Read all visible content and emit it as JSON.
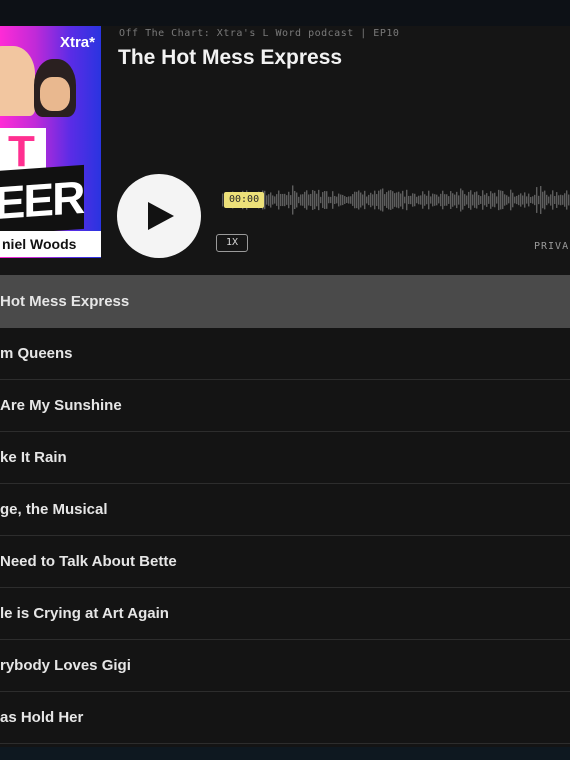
{
  "player": {
    "meta": "Off The Chart: Xtra's L Word podcast | EP10",
    "title": "The Hot Mess Express",
    "time": "00:00",
    "speed": "1X",
    "privacy": "PRIVA",
    "cover": {
      "brand": "Xtra*",
      "big_letter": "T",
      "headline": "EER",
      "host": "niel Woods"
    }
  },
  "episodes": [
    " Hot Mess Express",
    "m Queens",
    " Are My Sunshine",
    "ke It Rain",
    "ge, the Musical",
    " Need to Talk About Bette",
    "le is Crying at Art Again",
    "rybody Loves Gigi",
    "as Hold Her"
  ],
  "colors": {
    "background": "#141414",
    "active_row": "#4a4a4a",
    "time_badge": "#ece079",
    "waveform": "#5e5e5e",
    "play_button": "#f4f4f4"
  },
  "icons": {
    "play": "play-icon"
  }
}
